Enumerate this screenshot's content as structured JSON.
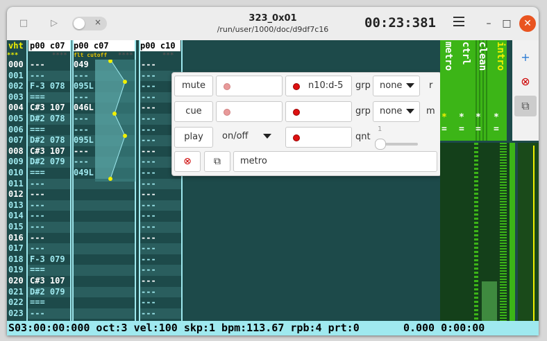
{
  "window": {
    "title": "323_0x01",
    "path": "/run/user/1000/doc/d9df7c16",
    "clock": "00:23:381",
    "toggle_symbol": "×",
    "stop_symbol": "□",
    "play_symbol": "▷",
    "minimize_symbol": "–",
    "maximize_symbol": "□",
    "close_symbol": "✕"
  },
  "pattern": {
    "vht_header": "vht",
    "stars": "***",
    "col1_header": "p00 c07",
    "col1_stars": "****",
    "col2_header": "p00 c07",
    "col2_sub": "flt cutoff",
    "col2_stars": "****",
    "col3_header": "p00 c10",
    "col3_stars": "***",
    "rows": [
      "000",
      "001",
      "002",
      "003",
      "004",
      "005",
      "006",
      "007",
      "008",
      "009",
      "010",
      "011",
      "012",
      "013",
      "014",
      "015",
      "016",
      "017",
      "018",
      "019",
      "020",
      "021",
      "022",
      "023"
    ],
    "col1": [
      "---",
      "---",
      "F-3 078",
      "===",
      "C#3 107",
      "D#2 078",
      "===",
      "D#2 078",
      "C#3 107",
      "D#2 079",
      "===",
      "---",
      "---",
      "---",
      "---",
      "---",
      "---",
      "---",
      "F-3 079",
      "===",
      "C#3 107",
      "D#2 079",
      "===",
      "---"
    ],
    "col2": [
      "049",
      "---",
      "095L",
      "---",
      "046L",
      "---",
      "---",
      "095L",
      "---",
      "---",
      "049L",
      "",
      "",
      "",
      "",
      "",
      "",
      "",
      "",
      "",
      "",
      "",
      "",
      ""
    ],
    "col3": [
      "---",
      "---",
      "---",
      "---",
      "---",
      "---",
      "---",
      "---",
      "---",
      "---",
      "---",
      "---",
      "---",
      "---",
      "---",
      "---",
      "---",
      "---",
      "---",
      "---",
      "---",
      "---",
      "---",
      "---"
    ]
  },
  "popup": {
    "mute_label": "mute",
    "cue_label": "cue",
    "play_label": "play",
    "play_mode": "on/off",
    "note": "n10:d-5",
    "grp_label": "grp",
    "grp1": "none",
    "grp2": "none",
    "r_label": "r",
    "m_label": "m",
    "qnt_label": "qnt",
    "qnt_value": "1",
    "name": "metro"
  },
  "tracks": [
    {
      "name": "metro",
      "btn1": "*",
      "btn2": "="
    },
    {
      "name": "ctrl",
      "btn1": "*",
      "btn2": "="
    },
    {
      "name": "clean",
      "btn1": "*",
      "btn2": "="
    },
    {
      "name": "intro",
      "btn1": "*",
      "btn2": "="
    }
  ],
  "side_buttons": {
    "add": "+",
    "remove": "⊗",
    "copy": "⧉"
  },
  "status": "S03:00:00:000 oct:3 vel:100 skp:1 bpm:113.67 rpb:4 prt:0       0.000 0:00:00",
  "colors": {
    "accent": "#9fe9ef",
    "bg": "#1d4a4a",
    "green": "#3cb517",
    "yellow": "#f0f000"
  }
}
